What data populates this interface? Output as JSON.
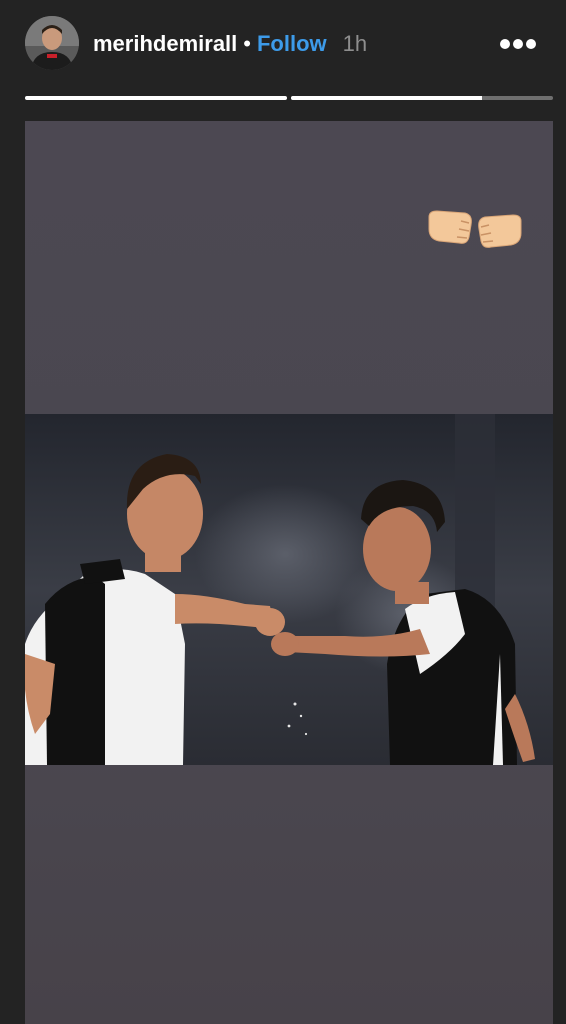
{
  "header": {
    "username": "merihdemirall",
    "separator": "•",
    "follow_label": "Follow",
    "time": "1h"
  },
  "icons": {
    "more": "more-options-icon",
    "sticker": "fist-bump-icon"
  },
  "progress": {
    "segments": [
      {
        "fill": 1.0
      },
      {
        "fill": 0.73
      }
    ]
  },
  "colors": {
    "follow": "#3d9be9",
    "background": "#232323",
    "story_bg": "#4b4851"
  }
}
